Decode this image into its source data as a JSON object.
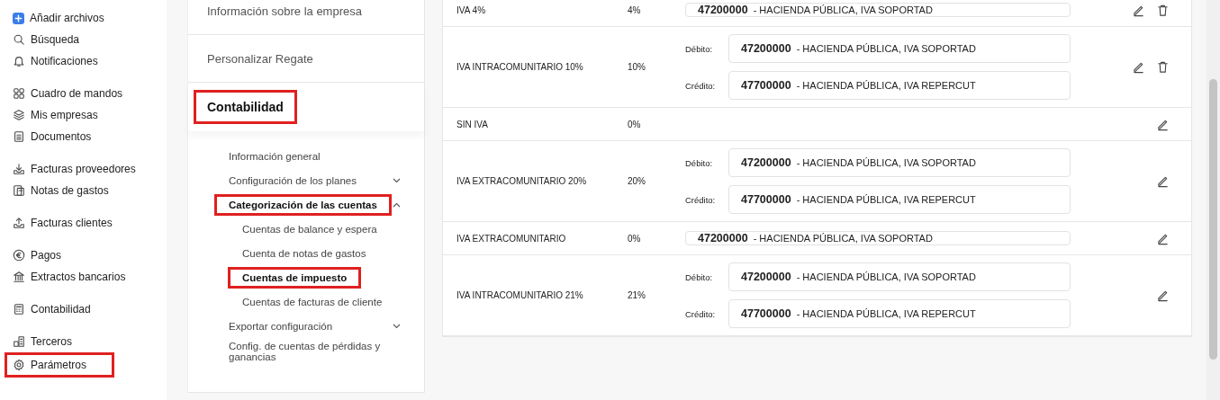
{
  "nav": {
    "groups": [
      [
        {
          "label": "Añadir archivos",
          "highlighted": false
        },
        {
          "label": "Búsqueda",
          "highlighted": false
        },
        {
          "label": "Notificaciones",
          "highlighted": false
        }
      ],
      [
        {
          "label": "Cuadro de mandos",
          "highlighted": false
        },
        {
          "label": "Mis empresas",
          "highlighted": false
        },
        {
          "label": "Documentos",
          "highlighted": false
        }
      ],
      [
        {
          "label": "Facturas proveedores",
          "highlighted": false
        },
        {
          "label": "Notas de gastos",
          "highlighted": false
        }
      ],
      [
        {
          "label": "Facturas clientes",
          "highlighted": false
        }
      ],
      [
        {
          "label": "Pagos",
          "highlighted": false
        },
        {
          "label": "Extractos bancarios",
          "highlighted": false
        }
      ],
      [
        {
          "label": "Contabilidad",
          "highlighted": false
        }
      ],
      [
        {
          "label": "Terceros",
          "highlighted": false
        },
        {
          "label": "Parámetros",
          "highlighted": true
        }
      ]
    ]
  },
  "settings": {
    "sections": [
      {
        "label": "Información sobre la empresa",
        "selected": false,
        "highlighted": false
      },
      {
        "label": "Personalizar Regate",
        "selected": false,
        "highlighted": false
      },
      {
        "label": "Contabilidad",
        "selected": true,
        "highlighted": true,
        "children": [
          {
            "label": "Información general",
            "selected": false,
            "highlighted": false
          },
          {
            "label": "Configuración de los planes",
            "selected": false,
            "highlighted": false,
            "expanded": false
          },
          {
            "label": "Categorización de las cuentas",
            "selected": false,
            "highlighted": true,
            "expanded": true,
            "children": [
              {
                "label": "Cuentas de balance y espera",
                "selected": false,
                "highlighted": false
              },
              {
                "label": "Cuenta de notas de gastos",
                "selected": false,
                "highlighted": false
              },
              {
                "label": "Cuentas de impuesto",
                "selected": true,
                "highlighted": true
              },
              {
                "label": "Cuentas de facturas de cliente",
                "selected": false,
                "highlighted": false
              }
            ]
          },
          {
            "label": "Exportar configuración",
            "selected": false,
            "highlighted": false,
            "expanded": false
          },
          {
            "label": "Config. de cuentas de pérdidas y ganancias",
            "selected": false,
            "highlighted": false
          }
        ]
      }
    ]
  },
  "tax_table": {
    "rows": [
      {
        "name": "IVA 4%",
        "rate": "4%",
        "kind": "single",
        "deletable": true,
        "accounts": [
          {
            "account": "47200000",
            "description": "- HACIENDA PÚBLICA, IVA SOPORTAD"
          }
        ]
      },
      {
        "name": "IVA INTRACOMUNITARIO 10%",
        "rate": "10%",
        "kind": "split",
        "deletable": true,
        "accounts": [
          {
            "label": "Débito:",
            "account": "47200000",
            "description": "- HACIENDA PÚBLICA, IVA SOPORTAD"
          },
          {
            "label": "Crédito:",
            "account": "47700000",
            "description": "- HACIENDA PÚBLICA, IVA REPERCUT"
          }
        ]
      },
      {
        "name": "SIN IVA",
        "rate": "0%",
        "kind": "none",
        "deletable": false
      },
      {
        "name": "IVA EXTRACOMUNITARIO 20%",
        "rate": "20%",
        "kind": "split",
        "deletable": false,
        "accounts": [
          {
            "label": "Débito:",
            "account": "47200000",
            "description": "- HACIENDA PÚBLICA, IVA SOPORTAD"
          },
          {
            "label": "Crédito:",
            "account": "47700000",
            "description": "- HACIENDA PÚBLICA, IVA REPERCUT"
          }
        ]
      },
      {
        "name": "IVA EXTRACOMUNITARIO",
        "rate": "0%",
        "kind": "single",
        "deletable": false,
        "accounts": [
          {
            "account": "47200000",
            "description": "- HACIENDA PÚBLICA, IVA SOPORTAD"
          }
        ]
      },
      {
        "name": "IVA INTRACOMUNITARIO 21%",
        "rate": "21%",
        "kind": "split",
        "deletable": false,
        "accounts": [
          {
            "label": "Débito:",
            "account": "47200000",
            "description": "- HACIENDA PÚBLICA, IVA SOPORTAD"
          },
          {
            "label": "Crédito:",
            "account": "47700000",
            "description": "- HACIENDA PÚBLICA, IVA REPERCUT"
          }
        ]
      }
    ]
  }
}
